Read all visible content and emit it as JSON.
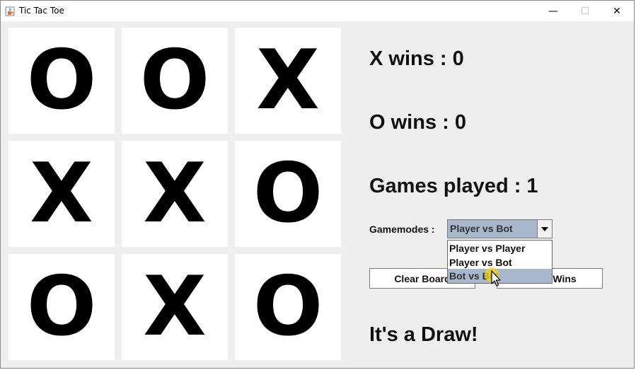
{
  "window": {
    "title": "Tic Tac Toe",
    "icon": "java-cup-icon",
    "controls": {
      "minimize": "—",
      "maximize": "☐",
      "close": "✕"
    }
  },
  "board": {
    "cells": [
      "O",
      "O",
      "X",
      "X",
      "X",
      "O",
      "O",
      "X",
      "O"
    ]
  },
  "stats": {
    "x_wins": "X wins : 0",
    "o_wins": "O wins : 0",
    "games_played": "Games played : 1"
  },
  "gamemode": {
    "label": "Gamemodes :",
    "selected": "Player vs Bot",
    "options": [
      "Player vs Player",
      "Player vs Bot",
      "Bot vs Bot"
    ],
    "highlighted_option": "Bot vs Bot",
    "dropdown_open": true
  },
  "buttons": {
    "clear_board": "Clear Board",
    "reset_wins": "Reset Wins"
  },
  "status": "It's a Draw!",
  "colors": {
    "selection": "#a8b8cc",
    "panel_bg": "#eeeeee",
    "cell_bg": "#ffffff",
    "cursor_highlight": "#f5d800"
  }
}
